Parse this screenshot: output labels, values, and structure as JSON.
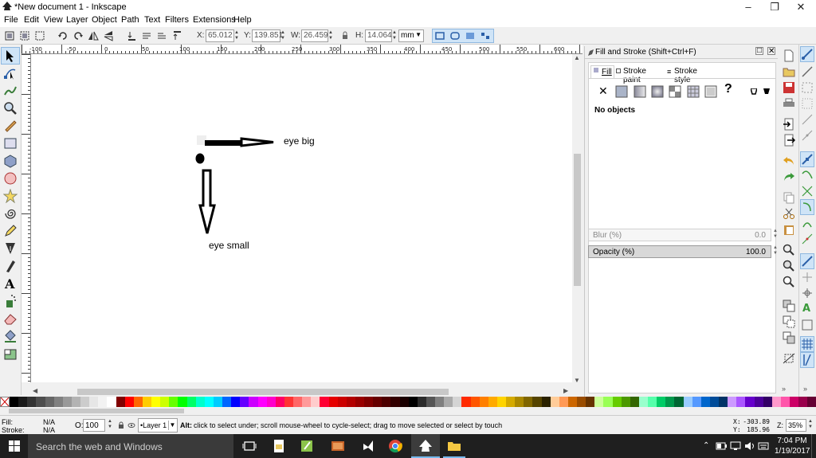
{
  "window": {
    "title": "*New document 1 - Inkscape"
  },
  "menu": [
    "File",
    "Edit",
    "View",
    "Layer",
    "Object",
    "Path",
    "Text",
    "Filters",
    "Extensions",
    "Help"
  ],
  "controls": {
    "x_label": "X:",
    "x_value": "65.012",
    "y_label": "Y:",
    "y_value": "139.851",
    "w_label": "W:",
    "w_value": "26.459",
    "h_label": "H:",
    "h_value": "14.064",
    "unit": "mm"
  },
  "ruler": {
    "labels": [
      "-100",
      "-50",
      "0",
      "50",
      "100",
      "150",
      "200",
      "250",
      "300",
      "350",
      "400",
      "450",
      "500",
      "550",
      "600",
      "650"
    ]
  },
  "canvas": {
    "label_eye_big": "eye big",
    "label_eye_small": "eye small"
  },
  "dock": {
    "title": "Fill and Stroke (Shift+Ctrl+F)",
    "tabs": [
      "Fill",
      "Stroke paint",
      "Stroke style"
    ],
    "no_objects": "No objects",
    "blur_label": "Blur (%)",
    "blur_value": "0.0",
    "opacity_label": "Opacity (%)",
    "opacity_value": "100.0",
    "opacity_level": 1.0
  },
  "status": {
    "fill_label": "Fill:",
    "fill_value": "N/A",
    "stroke_label": "Stroke:",
    "stroke_value": "N/A",
    "opacity_label": "O:",
    "opacity_value": "100",
    "layer": "•Layer 1",
    "hint_bold": "Alt:",
    "hint_text": "click to select under; scroll mouse-wheel to cycle-select; drag to move selected or select by touch",
    "cursor_x_label": "X:",
    "cursor_x": "-303.89",
    "cursor_y_label": "Y:",
    "cursor_y": "185.96",
    "zoom_label": "Z:",
    "zoom": "35%"
  },
  "taskbar": {
    "search_placeholder": "Search the web and Windows",
    "time": "7:04 PM",
    "date": "1/19/2017"
  },
  "colors": {
    "accent": "#0078d7",
    "selected_tool": "#cfe4f7",
    "taskbar": "#1f1f1f"
  },
  "palette_colors": [
    "#000000",
    "#1a1a1a",
    "#333333",
    "#4d4d4d",
    "#666666",
    "#808080",
    "#999999",
    "#b3b3b3",
    "#cccccc",
    "#e6e6e6",
    "#f2f2f2",
    "#ffffff",
    "#800000",
    "#ff0000",
    "#ff6600",
    "#ffcc00",
    "#ffff00",
    "#ccff00",
    "#66ff00",
    "#00ff00",
    "#00ff66",
    "#00ffcc",
    "#00ffff",
    "#00ccff",
    "#0066ff",
    "#0000ff",
    "#6600ff",
    "#cc00ff",
    "#ff00ff",
    "#ff00cc",
    "#ff0066",
    "#ff3333",
    "#ff6666",
    "#ff9999",
    "#ffcccc",
    "#ff0033",
    "#e60000",
    "#cc0000",
    "#b30000",
    "#990000",
    "#800000",
    "#660000",
    "#4d0000",
    "#330000",
    "#1a0000",
    "#000000",
    "#2b2b2b",
    "#555555",
    "#7f7f7f",
    "#aaaaaa",
    "#d4d4d4",
    "#ff2a00",
    "#ff5500",
    "#ff7f00",
    "#ffaa00",
    "#ffd400",
    "#d4aa00",
    "#aa8800",
    "#806600",
    "#554400",
    "#2b2200",
    "#ffcc99",
    "#ff9955",
    "#cc6600",
    "#994c00",
    "#663300",
    "#ccff99",
    "#99ff55",
    "#66cc00",
    "#4c9900",
    "#336600",
    "#99ffcc",
    "#55ffaa",
    "#00cc66",
    "#00994c",
    "#006633",
    "#99ccff",
    "#5599ff",
    "#0066cc",
    "#004c99",
    "#003366",
    "#cc99ff",
    "#aa55ff",
    "#6600cc",
    "#4c0099",
    "#330066",
    "#ff99cc",
    "#ff55aa",
    "#cc0066",
    "#99004c",
    "#660033"
  ]
}
